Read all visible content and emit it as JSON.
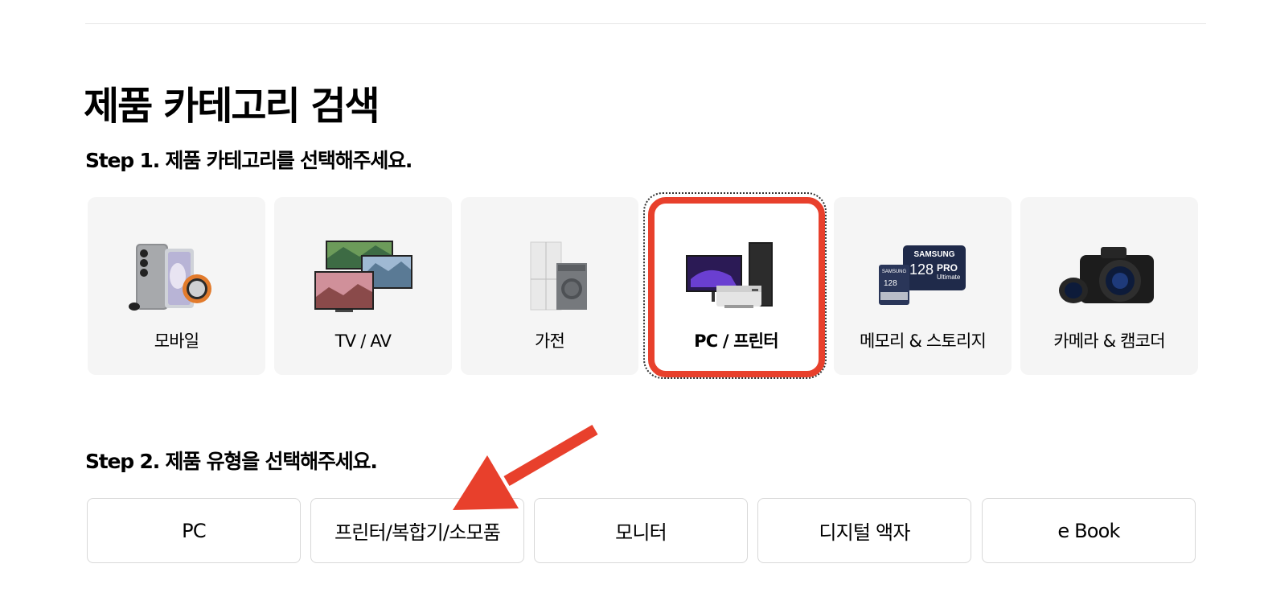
{
  "header": {
    "title": "제품 카테고리 검색"
  },
  "step1": {
    "title": "Step 1. 제품 카테고리를 선택해주세요.",
    "categories": [
      {
        "label": "모바일",
        "icon": "mobile-devices-image"
      },
      {
        "label": "TV / AV",
        "icon": "tv-av-image"
      },
      {
        "label": "가전",
        "icon": "appliances-image"
      },
      {
        "label": "PC / 프린터",
        "icon": "pc-printer-image",
        "selected": true
      },
      {
        "label": "메모리 & 스토리지",
        "icon": "memory-storage-image",
        "card_brand": "SAMSUNG",
        "card_capacity": "128",
        "card_line": "PRO",
        "card_sub": "Ultimate",
        "card_small_brand": "SAMSUNG",
        "card_small_capacity": "128"
      },
      {
        "label": "카메라 & 캠코더",
        "icon": "camera-image"
      }
    ]
  },
  "step2": {
    "title": "Step 2. 제품 유형을 선택해주세요.",
    "types": [
      {
        "label": "PC"
      },
      {
        "label": "프린터/복합기/소모품"
      },
      {
        "label": "모니터"
      },
      {
        "label": "디지털 액자"
      },
      {
        "label": "e Book"
      }
    ]
  },
  "annotation": {
    "highlight_color": "#e8402c",
    "arrow_color": "#e8402c"
  }
}
